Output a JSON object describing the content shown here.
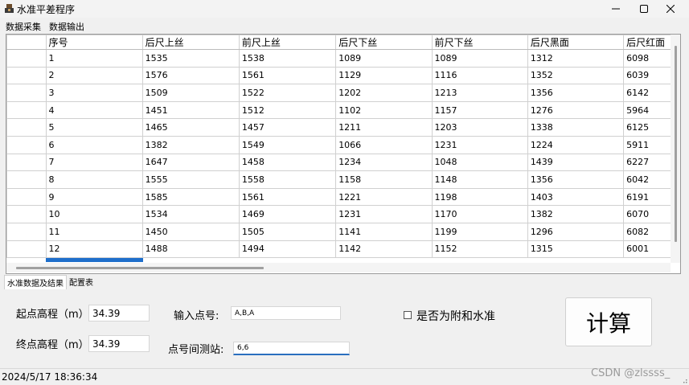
{
  "window": {
    "title": "水准平差程序"
  },
  "menu": [
    "数据采集",
    "数据输出"
  ],
  "grid": {
    "columns": [
      "序号",
      "后尺上丝",
      "前尺上丝",
      "后尺下丝",
      "前尺下丝",
      "后尺黑面",
      "后尺红面"
    ],
    "rows": [
      [
        "1",
        "1535",
        "1538",
        "1089",
        "1089",
        "1312",
        "6098"
      ],
      [
        "2",
        "1576",
        "1561",
        "1129",
        "1116",
        "1352",
        "6039"
      ],
      [
        "3",
        "1509",
        "1522",
        "1202",
        "1213",
        "1356",
        "6142"
      ],
      [
        "4",
        "1451",
        "1512",
        "1102",
        "1157",
        "1276",
        "5964"
      ],
      [
        "5",
        "1465",
        "1457",
        "1211",
        "1203",
        "1338",
        "6125"
      ],
      [
        "6",
        "1382",
        "1549",
        "1066",
        "1231",
        "1224",
        "5911"
      ],
      [
        "7",
        "1647",
        "1458",
        "1234",
        "1048",
        "1439",
        "6227"
      ],
      [
        "8",
        "1555",
        "1558",
        "1158",
        "1148",
        "1356",
        "6042"
      ],
      [
        "9",
        "1585",
        "1561",
        "1221",
        "1198",
        "1403",
        "6191"
      ],
      [
        "10",
        "1534",
        "1469",
        "1231",
        "1170",
        "1382",
        "6070"
      ],
      [
        "11",
        "1450",
        "1505",
        "1141",
        "1199",
        "1296",
        "6082"
      ],
      [
        "12",
        "1488",
        "1494",
        "1142",
        "1152",
        "1315",
        "6001"
      ]
    ]
  },
  "tabs": [
    "水准数据及结果",
    "配置表"
  ],
  "form": {
    "start_label": "起点高程（m）:",
    "start_value": "34.39",
    "end_label": "终点高程（m）:",
    "end_value": "34.39",
    "point_label": "输入点号:",
    "point_value": "A,B,A",
    "station_label": "点号间测站:",
    "station_value": "6,6",
    "checkbox_label": "是否为附和水准",
    "calc_button": "计算"
  },
  "status": {
    "datetime": "2024/5/17 18:36:34"
  },
  "watermark": "CSDN @zlssss_",
  "colors": {
    "accent": "#1e6ecb"
  },
  "icons": {
    "app": "app-icon",
    "minimize": "minimize-icon",
    "maximize": "maximize-icon",
    "close": "close-icon"
  }
}
